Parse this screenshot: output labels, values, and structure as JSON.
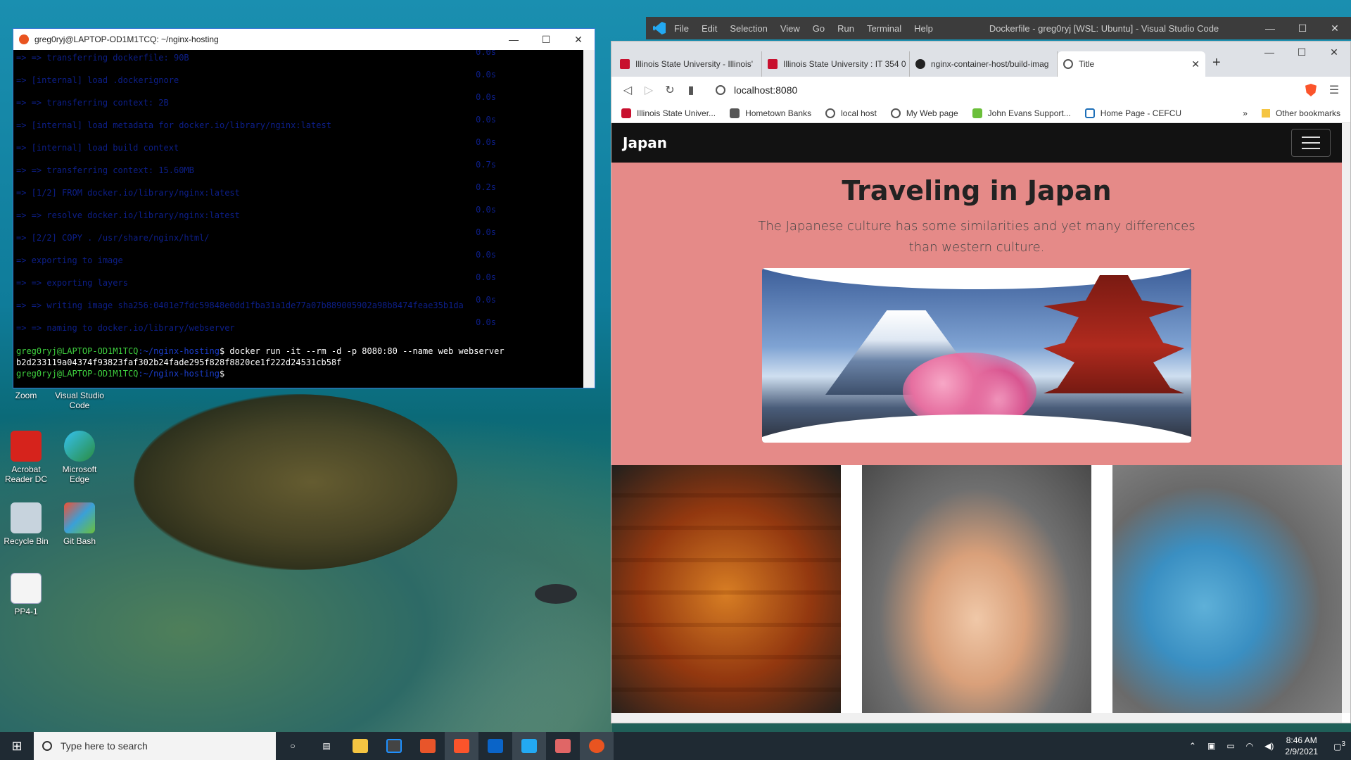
{
  "desktop": {
    "icons": [
      {
        "label": "Zoom"
      },
      {
        "label": "Visual Studio Code"
      },
      {
        "label": "Acrobat Reader DC"
      },
      {
        "label": "Microsoft Edge"
      },
      {
        "label": "Recycle Bin"
      },
      {
        "label": "Git Bash"
      },
      {
        "label": "PP4-1"
      }
    ]
  },
  "terminal": {
    "title": "greg0ryj@LAPTOP-OD1M1TCQ: ~/nginx-hosting",
    "faded_lines": [
      {
        "text": "=> => transferring dockerfile: 90B",
        "time": "0.0s"
      },
      {
        "text": "=> [internal] load .dockerignore",
        "time": "0.0s"
      },
      {
        "text": "=> => transferring context: 2B",
        "time": "0.0s"
      },
      {
        "text": "=> [internal] load metadata for docker.io/library/nginx:latest",
        "time": "0.0s"
      },
      {
        "text": "=> [internal] load build context",
        "time": "0.0s"
      },
      {
        "text": "=> => transferring context: 15.60MB",
        "time": "0.7s"
      },
      {
        "text": "=> [1/2] FROM docker.io/library/nginx:latest",
        "time": "0.2s"
      },
      {
        "text": "=> => resolve docker.io/library/nginx:latest",
        "time": "0.0s"
      },
      {
        "text": "=> [2/2] COPY . /usr/share/nginx/html/",
        "time": "0.0s"
      },
      {
        "text": "=> exporting to image",
        "time": "0.0s"
      },
      {
        "text": "=> => exporting layers",
        "time": "0.0s"
      },
      {
        "text": "=> => writing image sha256:0401e7fdc59848e0dd1fba31a1de77a07b889005902a98b8474feae35b1da",
        "time": "0.0s"
      },
      {
        "text": "=> => naming to docker.io/library/webserver",
        "time": "0.0s"
      }
    ],
    "prompt_user": "greg0ryj@LAPTOP-OD1M1TCQ",
    "prompt_path": ":~/nginx-hosting",
    "command": "$  docker run -it --rm -d -p 8080:80 --name web webserver",
    "output": "b2d233119a04374f93823faf302b24fade295f828f8820ce1f222d24531cb58f",
    "prompt_end": "$"
  },
  "vscode": {
    "menu": [
      "File",
      "Edit",
      "Selection",
      "View",
      "Go",
      "Run",
      "Terminal",
      "Help"
    ],
    "title": "Dockerfile - greg0ryj [WSL: Ubuntu] - Visual Studio Code"
  },
  "browser": {
    "tabs": [
      {
        "label": "Illinois State University - Illinois'"
      },
      {
        "label": "Illinois State University : IT 354 0"
      },
      {
        "label": "nginx-container-host/build-imag"
      },
      {
        "label": "Title"
      }
    ],
    "url": "localhost:8080",
    "bookmarks": [
      "Illinois State Univer...",
      "Hometown Banks",
      "local host",
      "My Web page",
      "John Evans Support...",
      "Home Page - CEFCU"
    ],
    "other_bookmarks": "Other bookmarks",
    "more": "»"
  },
  "site": {
    "brand": "Japan",
    "heading": "Traveling in Japan",
    "lead": "The Japanese culture has some similarities and yet many differences than western culture."
  },
  "taskbar": {
    "search_placeholder": "Type here to search",
    "time": "8:46 AM",
    "date": "2/9/2021",
    "notifications": "3"
  },
  "colors": {
    "hero_bg": "#e58a88",
    "navbar_bg": "#121212",
    "terminal_bg": "#000000",
    "prompt_green": "#3fd13f",
    "path_blue": "#1a3cc8"
  }
}
